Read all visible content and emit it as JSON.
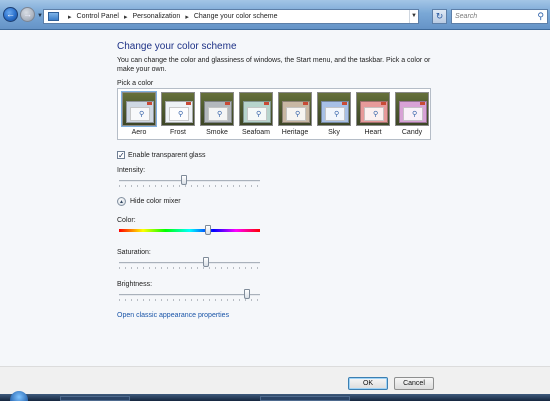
{
  "navbar": {
    "breadcrumbs": [
      "Control Panel",
      "Personalization",
      "Change your color scheme"
    ],
    "search_placeholder": "Search",
    "icons": {
      "back": "back-arrow-icon",
      "forward": "forward-arrow-icon",
      "refresh": "refresh-icon",
      "search": "search-icon"
    }
  },
  "content": {
    "title": "Change your color scheme",
    "intro": "You can change the color and glassiness of windows, the Start menu, and the taskbar. Pick a color or make your own.",
    "pick_label": "Pick a color",
    "swatches": [
      {
        "name": "Aero",
        "color": "#cfd8e3",
        "selected": true
      },
      {
        "name": "Frost",
        "color": "#eef2f6"
      },
      {
        "name": "Smoke",
        "color": "#b3b8bd"
      },
      {
        "name": "Seafoam",
        "color": "#b6d4cc"
      },
      {
        "name": "Heritage",
        "color": "#c8b7a3"
      },
      {
        "name": "Sky",
        "color": "#a7c0e6"
      },
      {
        "name": "Heart",
        "color": "#e79a9a"
      },
      {
        "name": "Candy",
        "color": "#d8a2d6"
      }
    ],
    "transparency": {
      "label": "Enable transparent glass",
      "checked": true
    },
    "intensity": {
      "label": "Intensity:",
      "level": 0.46
    },
    "mixer_toggle": "Hide color mixer",
    "color": {
      "label": "Color:",
      "level": 0.63
    },
    "saturation": {
      "label": "Saturation:",
      "level": 0.62
    },
    "brightness": {
      "label": "Brightness:",
      "level": 0.91
    },
    "classic_link": "Open classic appearance properties"
  },
  "buttons": {
    "ok": "OK",
    "cancel": "Cancel"
  }
}
